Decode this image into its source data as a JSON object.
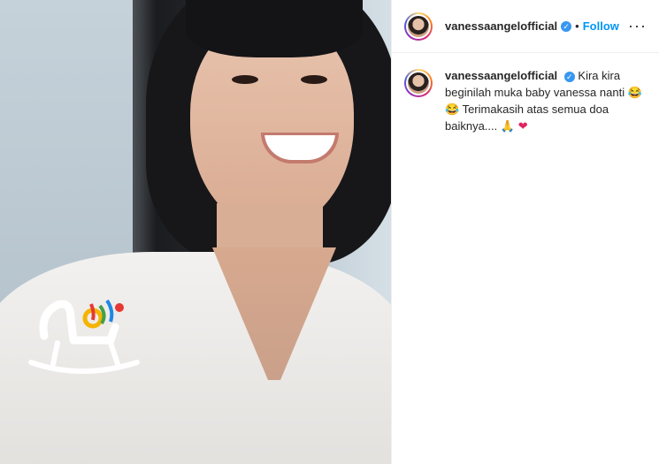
{
  "account": {
    "username": "vanessaangelofficial",
    "verified_icon": "verified-badge-icon",
    "follow_label": "Follow",
    "separator": "•",
    "more_label": "···"
  },
  "caption": {
    "username": "vanessaangelofficial",
    "text_1": "Kira kira beginilah muka baby vanessa nanti",
    "emoji_1": "😂",
    "emoji_2": "😂",
    "text_2": "Terimakasih atas semua doa baiknya....",
    "emoji_3": "🙏",
    "emoji_4": "❤"
  },
  "colors": {
    "follow": "#0095f6",
    "verified": "#3897f0",
    "text": "#262626"
  }
}
